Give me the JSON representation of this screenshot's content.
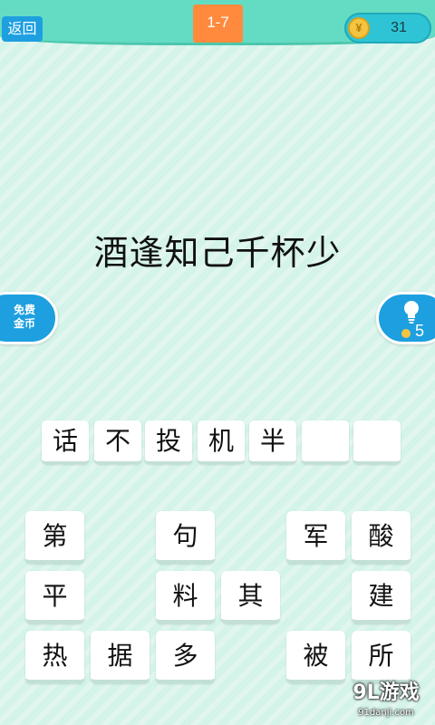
{
  "header": {
    "back_label": "返回",
    "level": "1-7",
    "coin_count": "31",
    "coin_glyph": "¥"
  },
  "puzzle": {
    "text": "酒逢知己千杯少"
  },
  "side": {
    "free_coins_line1": "免费",
    "free_coins_line2": "金币",
    "hint_count": "5"
  },
  "answer": {
    "slots": [
      "话",
      "不",
      "投",
      "机",
      "半",
      "",
      ""
    ]
  },
  "tiles": [
    {
      "char": "第"
    },
    {
      "char": "句"
    },
    {
      "char": "军"
    },
    {
      "char": "酸"
    },
    {
      "char": "平"
    },
    {
      "char": "料"
    },
    {
      "char": "其"
    },
    {
      "char": "建"
    },
    {
      "char": "热"
    },
    {
      "char": "据"
    },
    {
      "char": "多"
    },
    {
      "char": "被"
    },
    {
      "char": "所"
    }
  ],
  "watermark": {
    "brand": "9L游戏",
    "domain": "91danji.com"
  },
  "colors": {
    "background": "#d4f3e9",
    "topbar": "#64dcc3",
    "accent_blue": "#1d9fe0",
    "level_orange": "#ff8a3d",
    "coin_gold": "#f5c542"
  }
}
